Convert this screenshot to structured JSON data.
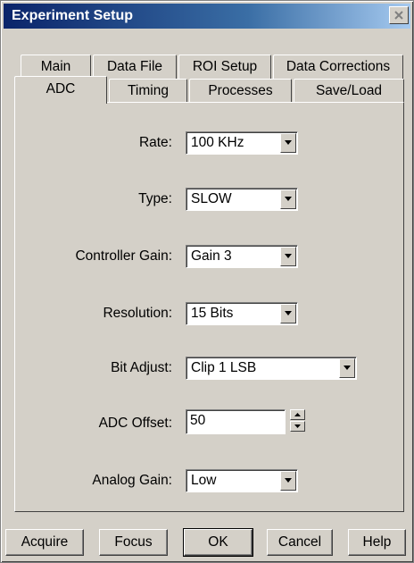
{
  "window": {
    "title": "Experiment Setup"
  },
  "tabs_back": [
    {
      "label": "Main"
    },
    {
      "label": "Data File"
    },
    {
      "label": "ROI Setup"
    },
    {
      "label": "Data Corrections"
    }
  ],
  "tabs_front": [
    {
      "label": "ADC",
      "active": true
    },
    {
      "label": "Timing"
    },
    {
      "label": "Processes"
    },
    {
      "label": "Save/Load"
    }
  ],
  "adc": {
    "rate": {
      "label": "Rate:",
      "value": "100 KHz"
    },
    "type": {
      "label": "Type:",
      "value": "SLOW"
    },
    "controller_gain": {
      "label": "Controller Gain:",
      "value": "Gain 3"
    },
    "resolution": {
      "label": "Resolution:",
      "value": "15 Bits"
    },
    "bit_adjust": {
      "label": "Bit Adjust:",
      "value": "Clip 1 LSB"
    },
    "adc_offset": {
      "label": "ADC Offset:",
      "value": "50"
    },
    "analog_gain": {
      "label": "Analog Gain:",
      "value": "Low"
    }
  },
  "buttons": {
    "acquire": "Acquire",
    "focus": "Focus",
    "ok": "OK",
    "cancel": "Cancel",
    "help": "Help"
  },
  "colors": {
    "face": "#d4d0c8",
    "title_start": "#0a246a",
    "title_end": "#a6caf0"
  }
}
